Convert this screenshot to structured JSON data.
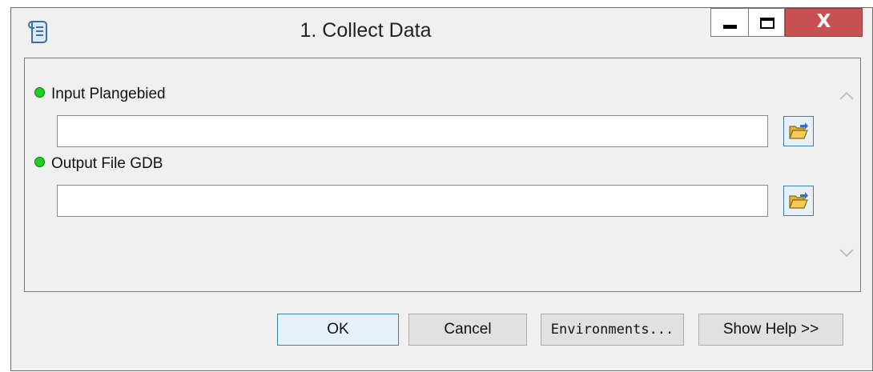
{
  "window": {
    "title": "1. Collect Data",
    "app_icon": "python-script-icon",
    "controls": {
      "minimize": "minimize-icon",
      "maximize": "maximize-icon",
      "close_label": "X"
    }
  },
  "parameters": [
    {
      "label": "Input Plangebied",
      "value": "",
      "status_color": "#1fd11f",
      "browse_icon": "open-folder-icon"
    },
    {
      "label": "Output File GDB",
      "value": "",
      "status_color": "#1fd11f",
      "browse_icon": "open-folder-icon"
    }
  ],
  "footer": {
    "ok_label": "OK",
    "cancel_label": "Cancel",
    "environments_label": "Environments...",
    "show_help_label": "Show Help >>"
  },
  "colors": {
    "close_button": "#c75050",
    "required_dot": "#1fd11f",
    "focus_border": "#3c7fb1"
  }
}
